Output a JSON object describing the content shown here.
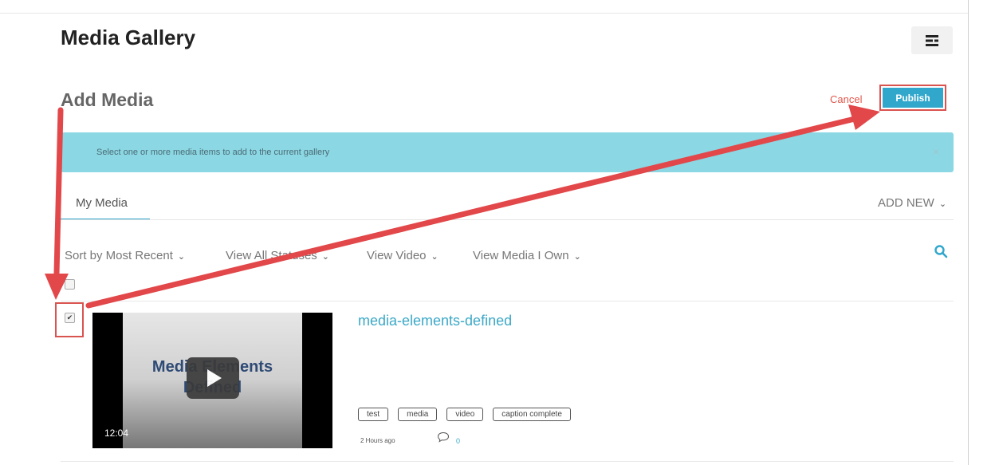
{
  "page": {
    "title": "Media Gallery"
  },
  "section": {
    "title": "Add Media"
  },
  "actions": {
    "cancel_label": "Cancel",
    "publish_label": "Publish"
  },
  "alert": {
    "message": "Select one or more media items to add to the current gallery",
    "close_label": "×"
  },
  "tabs": [
    {
      "label": "My Media",
      "active": true
    }
  ],
  "add_new_label": "ADD NEW",
  "filters": [
    {
      "label": "Sort by Most Recent"
    },
    {
      "label": "View All Statuses"
    },
    {
      "label": "View Video"
    },
    {
      "label": "View Media I Own"
    }
  ],
  "select_all_checked": false,
  "media": {
    "checked": true,
    "thumbnail_text": "Media Elements Defined",
    "duration": "12:04",
    "title": "media-elements-defined",
    "tags": [
      "test",
      "media",
      "video",
      "caption complete"
    ],
    "time_ago": "2 Hours ago",
    "comment_count": "0"
  },
  "colors": {
    "accent": "#31a7cc",
    "alert_bg": "#8bd7e4",
    "annotation_red": "#e2474a",
    "cancel": "#e2574c"
  },
  "icons": {
    "menu": "menu-lines-icon",
    "search": "search-icon",
    "comment": "comment-bubble-icon",
    "chevron": "chevron-down-icon"
  }
}
